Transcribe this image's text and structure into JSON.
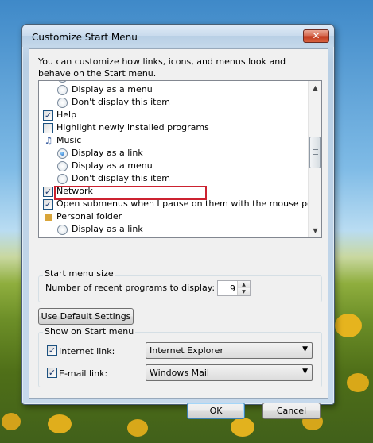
{
  "window": {
    "title": "Customize Start Menu",
    "close_glyph": "✕"
  },
  "intro_text": "You can customize how links, icons, and menus look and behave on the Start menu.",
  "list_items": [
    {
      "label": "Display as a link",
      "kind": "radio",
      "checked": true
    },
    {
      "label": "Display as a menu",
      "kind": "radio",
      "checked": false
    },
    {
      "label": "Don't display this item",
      "kind": "radio",
      "checked": false
    },
    {
      "label": "Help",
      "kind": "checkbox",
      "checked": true
    },
    {
      "label": "Highlight newly installed programs",
      "kind": "checkbox",
      "checked": false
    },
    {
      "label": "Music",
      "kind": "folder",
      "icon": "music-icon"
    },
    {
      "label": "Display as a link",
      "kind": "radio",
      "checked": true
    },
    {
      "label": "Display as a menu",
      "kind": "radio",
      "checked": false
    },
    {
      "label": "Don't display this item",
      "kind": "radio",
      "checked": false
    },
    {
      "label": "Network",
      "kind": "checkbox",
      "checked": true
    },
    {
      "label": "Open submenus when I pause on them with the mouse pointer",
      "kind": "checkbox",
      "checked": true
    },
    {
      "label": "Personal folder",
      "kind": "folder",
      "icon": "folder-icon"
    },
    {
      "label": "Display as a link",
      "kind": "radio",
      "checked": false
    }
  ],
  "start_menu_size": {
    "group_label": "Start menu size",
    "recent_label": "Number of recent programs to display:",
    "recent_value": "9"
  },
  "default_button": "Use Default Settings",
  "show_on_start": {
    "group_label": "Show on Start menu",
    "internet_label": "Internet link:",
    "internet_checked": true,
    "internet_value": "Internet Explorer",
    "email_label": "E-mail link:",
    "email_checked": true,
    "email_value": "Windows Mail"
  },
  "buttons": {
    "ok": "OK",
    "cancel": "Cancel"
  },
  "colors": {
    "highlight_outline": "#cc2230",
    "close_button": "#c0391e"
  }
}
